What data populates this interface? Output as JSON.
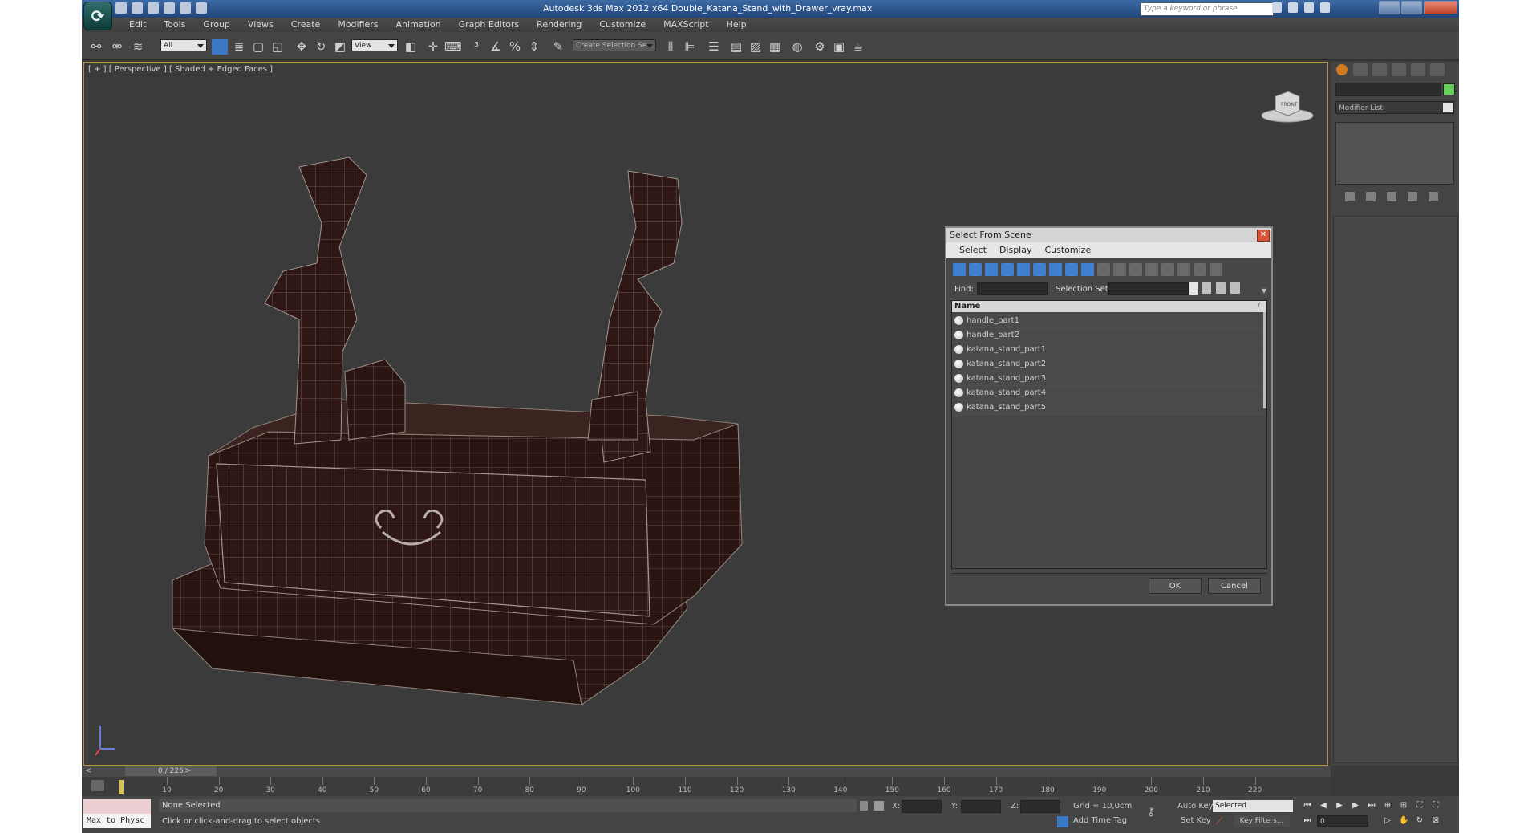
{
  "app": {
    "title": "Autodesk 3ds Max  2012 x64    Double_Katana_Stand_with_Drawer_vray.max",
    "search_placeholder": "Type a keyword or phrase"
  },
  "menu": [
    "Edit",
    "Tools",
    "Group",
    "Views",
    "Create",
    "Modifiers",
    "Animation",
    "Graph Editors",
    "Rendering",
    "Customize",
    "MAXScript",
    "Help"
  ],
  "toolbar": {
    "selection_filter": "All",
    "ref_coord": "View",
    "named_selection": "Create Selection Se"
  },
  "viewport": {
    "label": "[ + ] [ Perspective ] [ Shaded + Edged Faces ]",
    "viewcube_label": "FRONT"
  },
  "command_panel": {
    "modifier_list": "Modifier List",
    "object_color": "#68d15d"
  },
  "timeline": {
    "slider": "0 / 225",
    "ticks": [
      "10",
      "20",
      "30",
      "40",
      "50",
      "60",
      "70",
      "80",
      "90",
      "100",
      "110",
      "120",
      "130",
      "140",
      "150",
      "160",
      "170",
      "180",
      "190",
      "200",
      "210",
      "220"
    ]
  },
  "status": {
    "maxscript": "Max to Physc",
    "selection": "None Selected",
    "prompt": "Click or click-and-drag to select objects",
    "x_label": "X:",
    "y_label": "Y:",
    "z_label": "Z:",
    "grid": "Grid = 10,0cm",
    "add_time_tag": "Add Time Tag",
    "auto_key": "Auto Key",
    "set_key": "Set Key",
    "key_mode": "Selected",
    "key_filters": "Key Filters...",
    "frame": "0"
  },
  "dialog": {
    "title": "Select From Scene",
    "menu": [
      "Select",
      "Display",
      "Customize"
    ],
    "find_label": "Find:",
    "selection_set_label": "Selection Set:",
    "column_name": "Name",
    "items": [
      "handle_part1",
      "handle_part2",
      "katana_stand_part1",
      "katana_stand_part2",
      "katana_stand_part3",
      "katana_stand_part4",
      "katana_stand_part5"
    ],
    "ok": "OK",
    "cancel": "Cancel"
  }
}
